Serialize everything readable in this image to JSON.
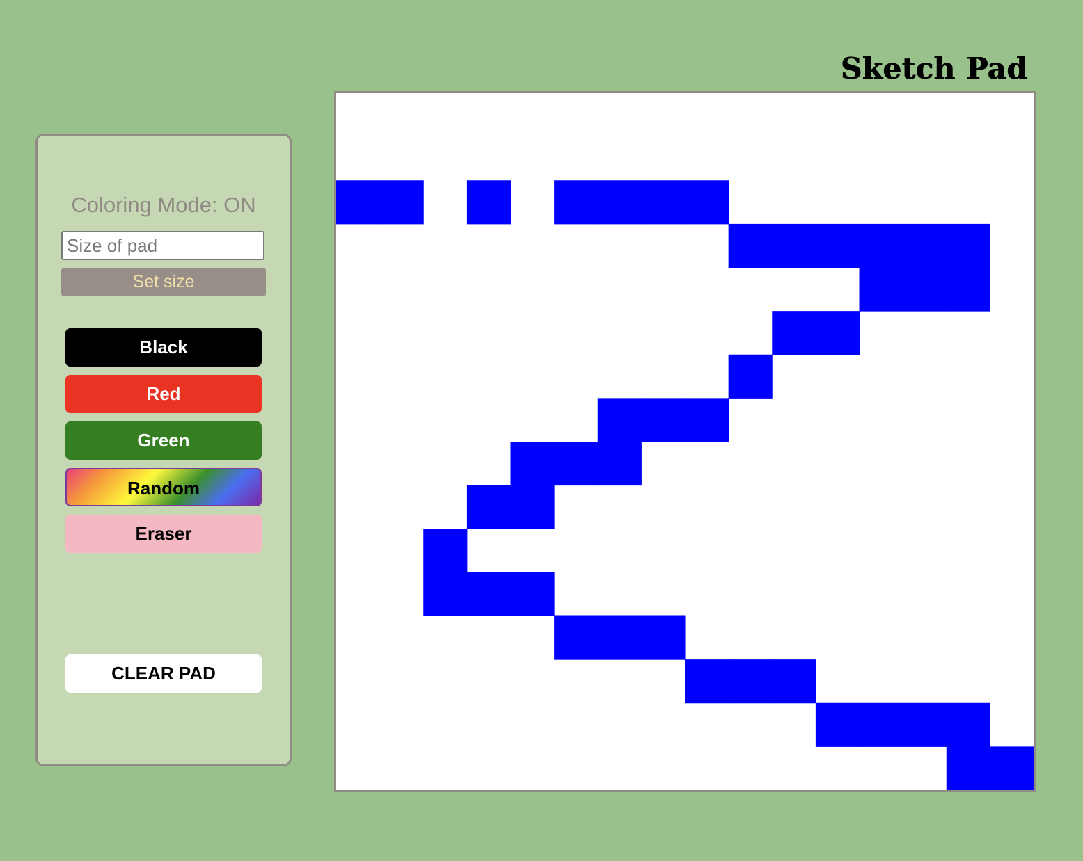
{
  "header": {
    "title": "Sketch Pad"
  },
  "panel": {
    "mode_text": "Coloring Mode: ON",
    "size_input": {
      "placeholder": "Size of pad",
      "value": ""
    },
    "set_size_label": "Set size",
    "color_buttons": [
      {
        "label": "Black",
        "color": "#000000"
      },
      {
        "label": "Red",
        "color": "#eb3323"
      },
      {
        "label": "Green",
        "color": "#367e22"
      },
      {
        "label": "Random",
        "color": "rainbow-gradient"
      },
      {
        "label": "Eraser",
        "color": "#f4b8c2"
      }
    ],
    "clear_label": "CLEAR PAD"
  },
  "pad": {
    "grid_size": 16,
    "paint_color": "#0000ff",
    "background_color": "#ffffff",
    "filled_cells": [
      [
        2,
        0
      ],
      [
        2,
        1
      ],
      [
        2,
        3
      ],
      [
        2,
        5
      ],
      [
        2,
        6
      ],
      [
        2,
        7
      ],
      [
        2,
        8
      ],
      [
        3,
        9
      ],
      [
        3,
        10
      ],
      [
        3,
        11
      ],
      [
        3,
        12
      ],
      [
        3,
        13
      ],
      [
        3,
        14
      ],
      [
        4,
        12
      ],
      [
        4,
        13
      ],
      [
        4,
        14
      ],
      [
        5,
        10
      ],
      [
        5,
        11
      ],
      [
        6,
        9
      ],
      [
        7,
        6
      ],
      [
        7,
        7
      ],
      [
        7,
        8
      ],
      [
        8,
        4
      ],
      [
        8,
        5
      ],
      [
        8,
        6
      ],
      [
        9,
        3
      ],
      [
        9,
        4
      ],
      [
        10,
        2
      ],
      [
        11,
        2
      ],
      [
        11,
        3
      ],
      [
        11,
        4
      ],
      [
        12,
        5
      ],
      [
        12,
        6
      ],
      [
        12,
        7
      ],
      [
        13,
        8
      ],
      [
        13,
        9
      ],
      [
        13,
        10
      ],
      [
        14,
        11
      ],
      [
        14,
        12
      ],
      [
        14,
        13
      ],
      [
        14,
        14
      ],
      [
        15,
        14
      ],
      [
        15,
        15
      ]
    ]
  }
}
